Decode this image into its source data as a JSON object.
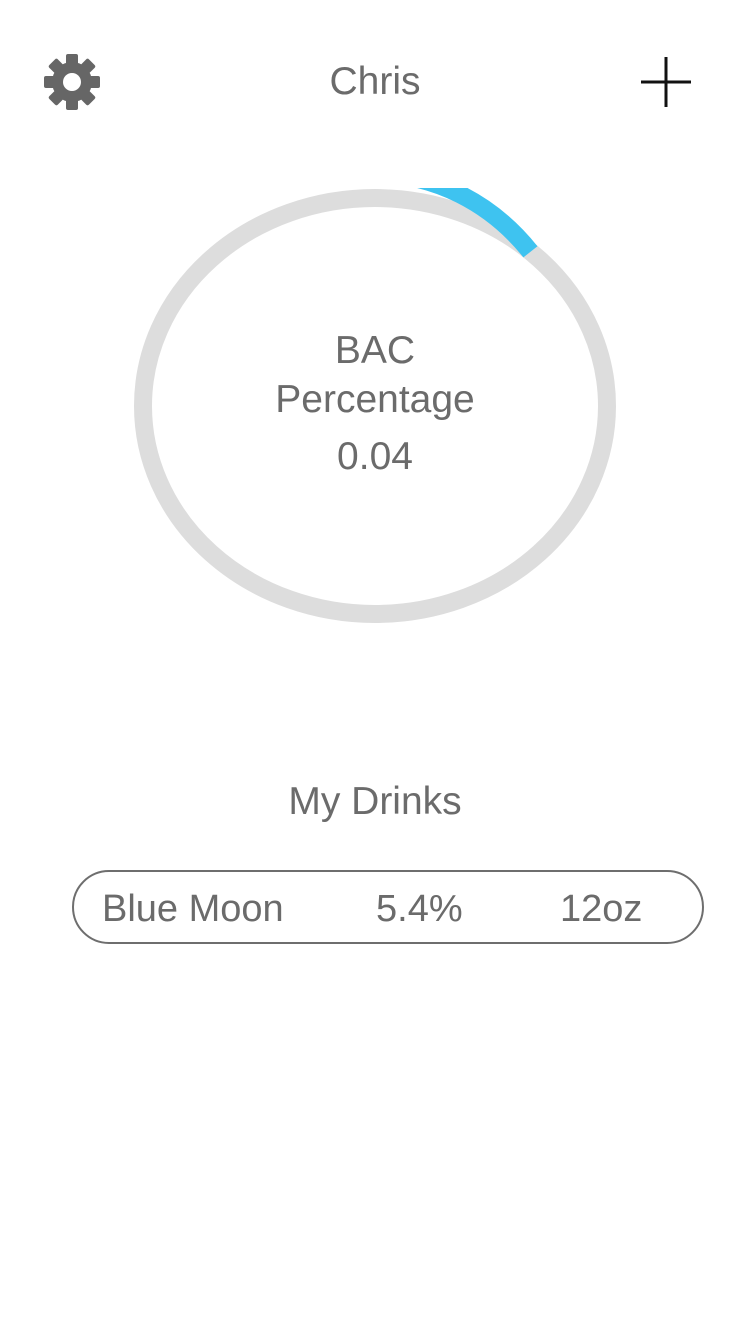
{
  "header": {
    "user_name": "Chris",
    "settings_icon": "gear-icon",
    "add_icon": "plus-icon"
  },
  "bac_gauge": {
    "label": "BAC\nPercentage",
    "value": "0.04",
    "progress_fraction": 0.13,
    "track_color": "#dddddd",
    "fill_color": "#3ec3f0"
  },
  "drinks": {
    "title": "My Drinks",
    "items": [
      {
        "name": "Blue Moon",
        "abv": "5.4%",
        "size": "12oz"
      }
    ]
  },
  "colors": {
    "text": "#6b6b6b",
    "icon": "#666666",
    "accent": "#3ec3f0"
  }
}
